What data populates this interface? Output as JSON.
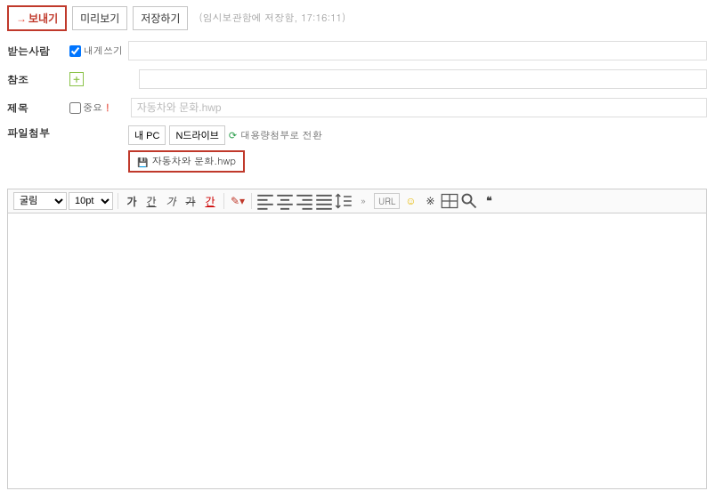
{
  "toolbar": {
    "send_label": "보내기",
    "preview_label": "미리보기",
    "save_label": "저장하기",
    "status_text": "(임시보관함에 저장함, 17:16:11)"
  },
  "form": {
    "recipient_label": "받는사람",
    "send_to_self_label": "내게쓰기",
    "cc_label": "참조",
    "subject_label": "제목",
    "important_label": "중요",
    "subject_placeholder": "자동차와 문화.hwp",
    "attachment_label": "파일첨부",
    "my_pc_btn": "내 PC",
    "ndrive_btn": "N드라이브",
    "big_attach_label": "대용량첨부로 전환",
    "attached_file": "자동차와 문화.hwp"
  },
  "editor": {
    "font_family": "굴림",
    "font_size": "10pt",
    "bold": "가",
    "underline": "간",
    "italic": "가",
    "strike": "가",
    "color": "간",
    "url_label": "URL",
    "more": "»"
  }
}
